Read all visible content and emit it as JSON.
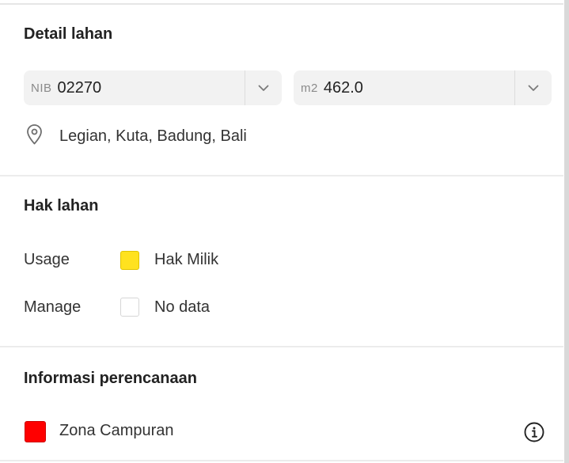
{
  "land_detail": {
    "title": "Detail lahan",
    "nib": {
      "prefix": "NIB",
      "value": "02270"
    },
    "area": {
      "prefix": "m2",
      "value": "462.0"
    },
    "location": "Legian, Kuta, Badung, Bali"
  },
  "land_rights": {
    "title": "Hak lahan",
    "rows": [
      {
        "label": "Usage",
        "value": "Hak Milik",
        "color": "#FFE21F"
      },
      {
        "label": "Manage",
        "value": "No data",
        "color": "#FFFFFF"
      }
    ]
  },
  "planning": {
    "title": "Informasi perencanaan",
    "zone": {
      "label": "Zona Campuran",
      "color": "#FF0000"
    }
  },
  "icons": [
    "chevron-down-icon",
    "location-pin-icon",
    "info-icon"
  ]
}
